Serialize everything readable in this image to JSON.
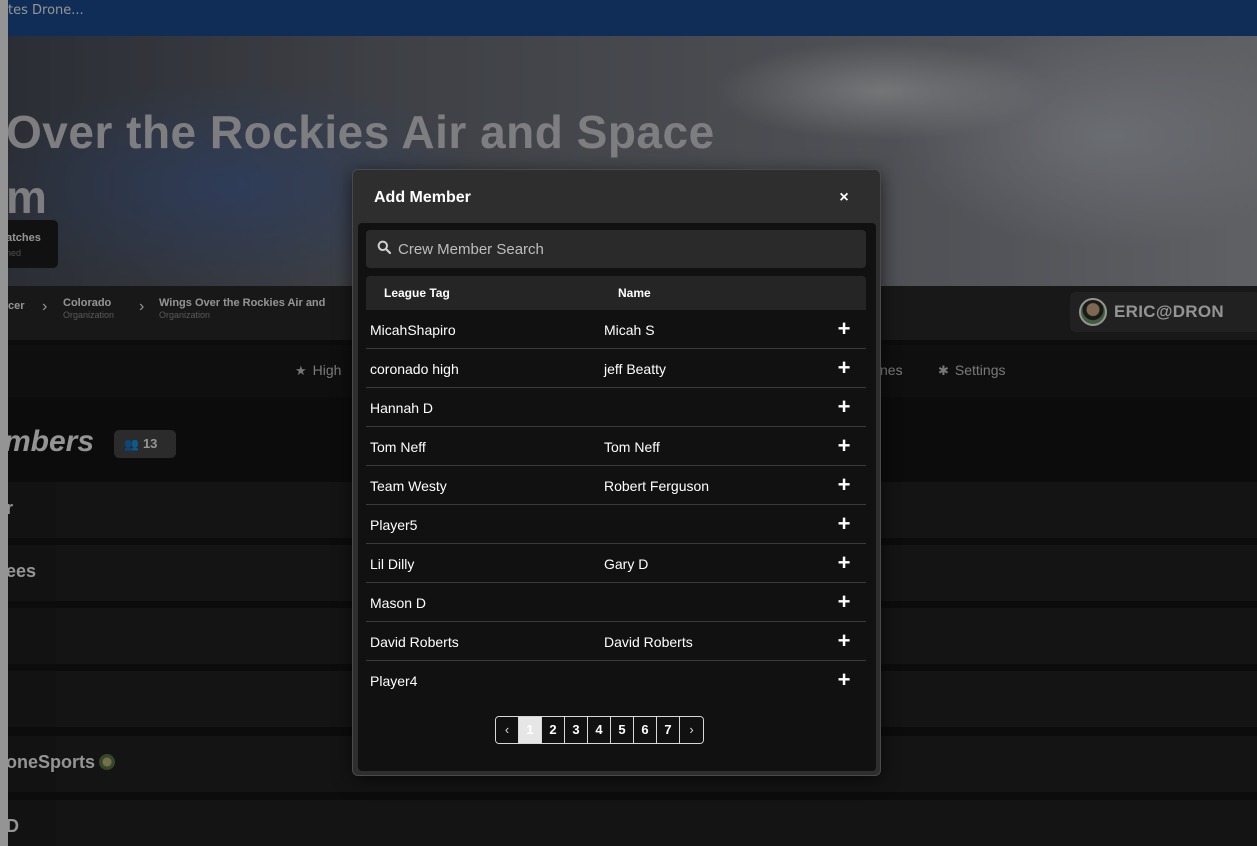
{
  "window": {
    "title": "tes Drone..."
  },
  "hero": {
    "title_line1": "Over the Rockies Air and Space",
    "title_line2": "m",
    "badge_label": "atches",
    "badge_sub": "ned"
  },
  "breadcrumb": {
    "first": "cer",
    "items": [
      {
        "name": "Colorado",
        "type": "Organization"
      },
      {
        "name": "Wings Over the Rockies Air and",
        "type": "Organization"
      }
    ],
    "user": "ERIC@DRON"
  },
  "tabs": {
    "highlights": "High",
    "partial": "nes",
    "settings": "Settings"
  },
  "members": {
    "heading": "mbers",
    "count": "13",
    "rows": [
      "r",
      "ees",
      "",
      "",
      "oneSports",
      "D"
    ]
  },
  "modal": {
    "title": "Add Member",
    "close": "×",
    "search_placeholder": "Crew Member Search",
    "columns": {
      "tag": "League Tag",
      "name": "Name"
    },
    "rows": [
      {
        "tag": "MicahShapiro",
        "name": "Micah S"
      },
      {
        "tag": "coronado high",
        "name": "jeff Beatty"
      },
      {
        "tag": "Hannah D",
        "name": ""
      },
      {
        "tag": "Tom Neff",
        "name": "Tom Neff"
      },
      {
        "tag": "Team Westy",
        "name": "Robert Ferguson"
      },
      {
        "tag": "Player5",
        "name": ""
      },
      {
        "tag": "Lil Dilly",
        "name": "Gary D"
      },
      {
        "tag": "Mason D",
        "name": ""
      },
      {
        "tag": "David Roberts",
        "name": "David Roberts"
      },
      {
        "tag": "Player4",
        "name": ""
      }
    ],
    "add_label": "+",
    "pagination": {
      "prev": "‹",
      "next": "›",
      "pages": [
        "1",
        "2",
        "3",
        "4",
        "5",
        "6",
        "7"
      ],
      "current": "1"
    }
  },
  "colors": {
    "titlebar": "#1c4f96",
    "modal_bg": "#2e2e2e",
    "table_bg": "#111111",
    "active_page": "#e6e6e6"
  }
}
